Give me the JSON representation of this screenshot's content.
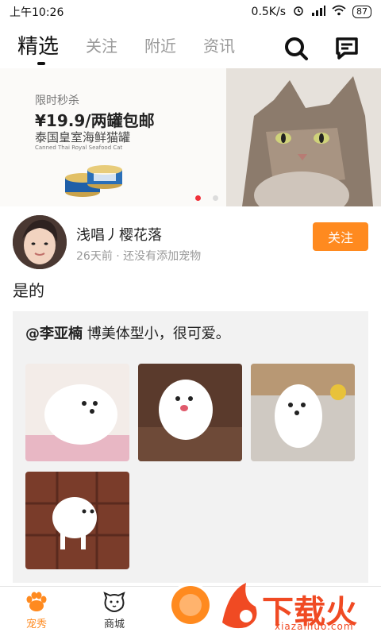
{
  "status_bar": {
    "time": "上午10:26",
    "speed": "0.5K/s",
    "battery": "87"
  },
  "top_nav": {
    "tabs": [
      {
        "label": "精选",
        "active": true
      },
      {
        "label": "关注",
        "active": false
      },
      {
        "label": "附近",
        "active": false
      },
      {
        "label": "资讯",
        "active": false
      }
    ],
    "icons": [
      "search-icon",
      "message-icon"
    ]
  },
  "banner": {
    "tag": "限时秒杀",
    "price": "¥19.9/两罐包邮",
    "product": "泰国皇室海鲜猫罐",
    "sub": "Canned Thai Royal Seafood Cat",
    "dots": 2,
    "active_dot": 0
  },
  "post": {
    "username": "浅唱丿樱花落",
    "meta": "26天前 · 还没有添加宠物",
    "follow_label": "关注",
    "text": "是的",
    "quote": {
      "mention": "@李亚楠",
      "text": " 博美体型小，很可爱。"
    }
  },
  "bottom_nav": {
    "items": [
      {
        "label": "宠秀",
        "icon": "paw-icon",
        "active": true
      },
      {
        "label": "商城",
        "icon": "dog-face-icon",
        "active": false
      }
    ]
  },
  "watermark": {
    "text": "下载火",
    "sub": "xiazaihuo.com"
  },
  "colors": {
    "accent": "#ff8a1f",
    "watermark": "#f04a23"
  }
}
